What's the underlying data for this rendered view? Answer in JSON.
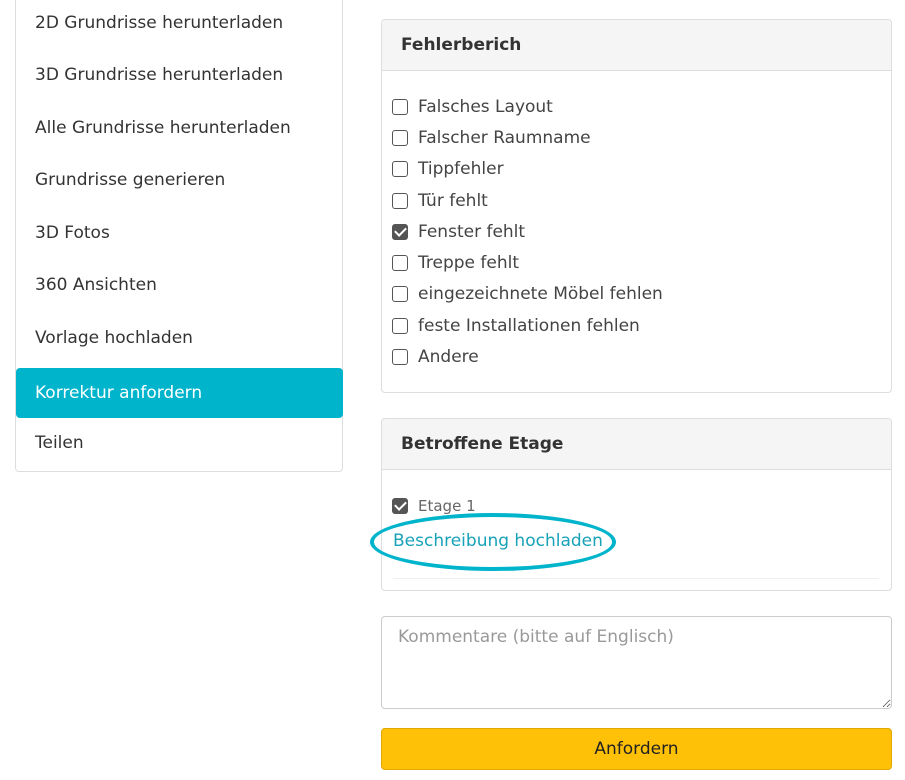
{
  "sidebar": {
    "items": [
      {
        "label": "2D Grundrisse herunterladen"
      },
      {
        "label": "3D Grundrisse herunterladen"
      },
      {
        "label": "Alle Grundrisse herunterladen"
      },
      {
        "label": "Grundrisse generieren"
      },
      {
        "label": "3D Fotos"
      },
      {
        "label": "360 Ansichten"
      },
      {
        "label": "Vorlage hochladen"
      },
      {
        "label": "Korrektur anfordern",
        "active": true
      },
      {
        "label": "Teilen"
      }
    ]
  },
  "error_panel": {
    "title": "Fehlerberich",
    "options": [
      {
        "label": "Falsches Layout",
        "checked": false
      },
      {
        "label": "Falscher Raumname",
        "checked": false
      },
      {
        "label": "Tippfehler",
        "checked": false
      },
      {
        "label": "Tür fehlt",
        "checked": false
      },
      {
        "label": "Fenster fehlt",
        "checked": true
      },
      {
        "label": "Treppe fehlt",
        "checked": false
      },
      {
        "label": "eingezeichnete Möbel fehlen",
        "checked": false
      },
      {
        "label": "feste Installationen fehlen",
        "checked": false
      },
      {
        "label": "Andere",
        "checked": false
      }
    ]
  },
  "floor_panel": {
    "title": "Betroffene Etage",
    "floor": {
      "label": "Etage 1",
      "checked": true
    },
    "upload_link": "Beschreibung hochladen"
  },
  "comment": {
    "value": "",
    "placeholder": "Kommentare (bitte auf Englisch)"
  },
  "submit_label": "Anfordern",
  "colors": {
    "accent": "#00b4cc",
    "link": "#17a2b8",
    "submit": "#ffc107",
    "checkbox_checked": "#555555"
  }
}
